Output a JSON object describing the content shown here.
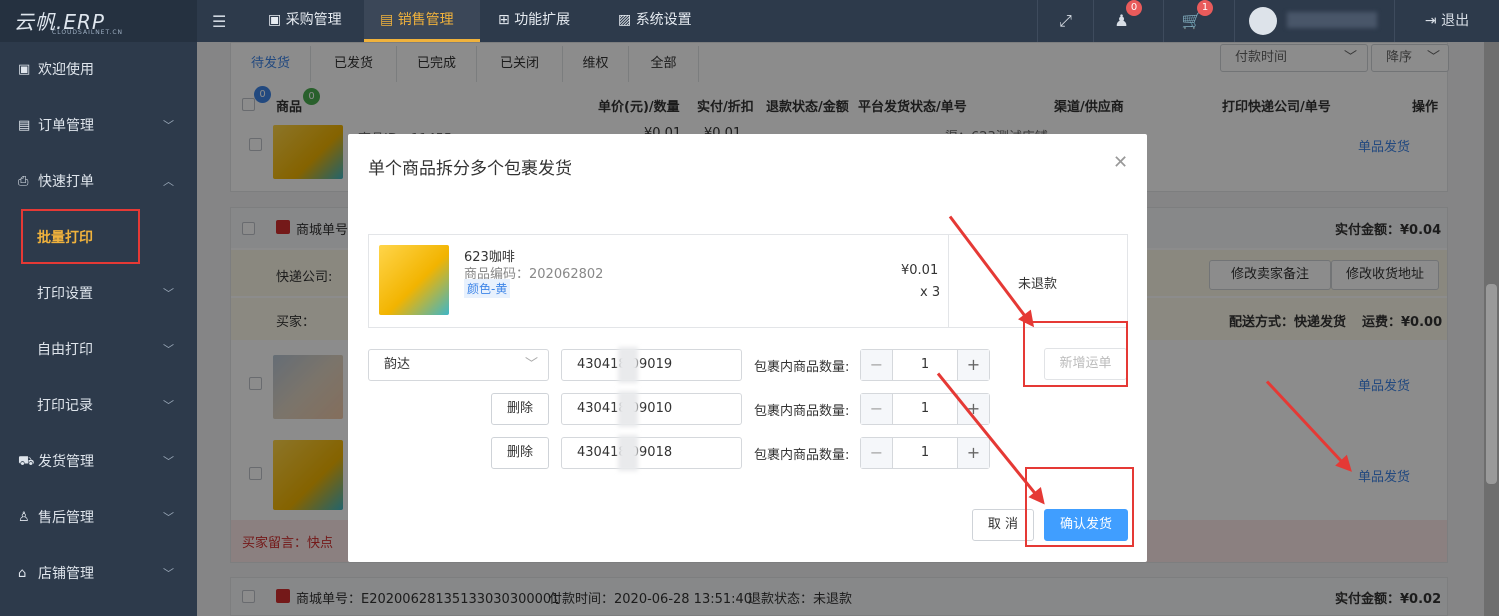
{
  "header": {
    "brand": "云帆.ERP",
    "brand_sub": "CLOUDSAILNET.CN",
    "nav": [
      "采购管理",
      "销售管理",
      "功能扩展",
      "系统设置"
    ],
    "msg_badge": "0",
    "cart_badge": "1",
    "logout": "退出"
  },
  "sidebar": {
    "items": [
      "欢迎使用",
      "订单管理",
      "快速打单",
      "批量打印",
      "打印设置",
      "自由打印",
      "打印记录",
      "发货管理",
      "售后管理",
      "店铺管理"
    ]
  },
  "tabs": [
    "待发货",
    "已发货",
    "已完成",
    "已关闭",
    "维权",
    "全部"
  ],
  "sort": {
    "field": "付款时间",
    "order": "降序"
  },
  "table": {
    "badge_a": "0",
    "badge_b": "0",
    "headers": [
      "商品",
      "单价(元)/数量",
      "实付/折扣",
      "退款状态/金额",
      "平台发货状态/单号",
      "渠道/供应商",
      "打印快递公司/单号",
      "操作"
    ],
    "ship_link": "单品发货"
  },
  "order1": {
    "product_id": "商品ID：11455",
    "price": "¥0.01",
    "paid": "¥0.01",
    "channel": "渠：623测试店铺"
  },
  "order2": {
    "label": "商城单号",
    "paid": "实付金额：¥0.04",
    "courier": "快递公司:",
    "seller_note_btn": "修改卖家备注",
    "address_btn": "修改收货地址",
    "buyer": "买家：",
    "delivery": "配送方式：快递发货",
    "freight": "运费：¥0.00",
    "message": "买家留言：快点"
  },
  "order3": {
    "order_no": "商城单号：E2020062813513303030000​1",
    "pay_time": "付款时间：2020-06-28 13:51:40",
    "refund": "退款状态：未退款",
    "paid": "实付金额：¥0.02"
  },
  "dialog": {
    "title": "单个商品拆分多个包裹发货",
    "product": {
      "name": "623咖啡",
      "code": "商品编码：202062802",
      "sku": "颜色-黄",
      "price": "¥0.01",
      "qty": "x 3",
      "refund": "未退款"
    },
    "courier": "韵达",
    "qty_label": "包裹内商品数量:",
    "add_btn": "新增运单",
    "delete_btn": "删除",
    "parcels": [
      {
        "no": "430418 09019",
        "qty": "1"
      },
      {
        "no": "430418 09010",
        "qty": "1"
      },
      {
        "no": "430418 09018",
        "qty": "1"
      }
    ],
    "cancel": "取 消",
    "confirm": "确认发货"
  }
}
